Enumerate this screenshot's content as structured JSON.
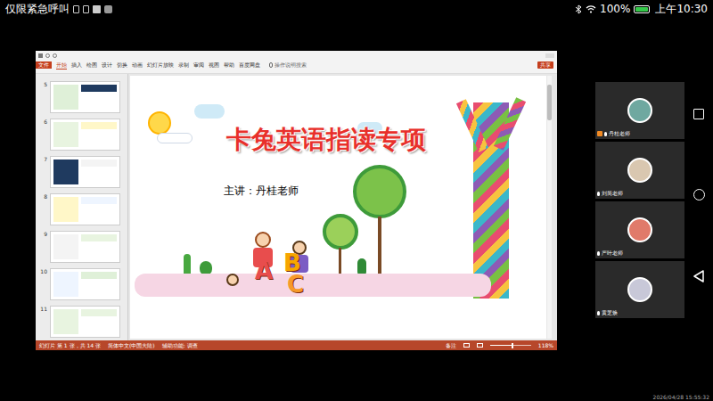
{
  "status_bar": {
    "left_text": "仅限紧急呼叫",
    "battery": "100%",
    "battery_level": 1,
    "time": "上午10:30"
  },
  "ppt": {
    "ribbon_tabs": [
      {
        "label": "文件",
        "selected": false,
        "kind": "file"
      },
      {
        "label": "开始",
        "selected": true,
        "kind": "tab"
      },
      {
        "label": "插入",
        "selected": false,
        "kind": "tab"
      },
      {
        "label": "绘图",
        "selected": false,
        "kind": "tab"
      },
      {
        "label": "设计",
        "selected": false,
        "kind": "tab"
      },
      {
        "label": "切换",
        "selected": false,
        "kind": "tab"
      },
      {
        "label": "动画",
        "selected": false,
        "kind": "tab"
      },
      {
        "label": "幻灯片放映",
        "selected": false,
        "kind": "tab"
      },
      {
        "label": "录制",
        "selected": false,
        "kind": "tab"
      },
      {
        "label": "审阅",
        "selected": false,
        "kind": "tab"
      },
      {
        "label": "视图",
        "selected": false,
        "kind": "tab"
      },
      {
        "label": "帮助",
        "selected": false,
        "kind": "tab"
      },
      {
        "label": "百度网盘",
        "selected": false,
        "kind": "tab"
      }
    ],
    "search": "操作说明搜索",
    "share": "共享",
    "thumbnails": [
      {
        "number": "5"
      },
      {
        "number": "6"
      },
      {
        "number": "7"
      },
      {
        "number": "8"
      },
      {
        "number": "9"
      },
      {
        "number": "10"
      },
      {
        "number": "11"
      }
    ],
    "slide": {
      "title": "卡兔英语指读专项",
      "speaker": "主讲：丹桂老师",
      "letters": [
        "A",
        "B",
        "C"
      ]
    },
    "status": {
      "slide_info": "幻灯片 第 1 张，共 14 张",
      "language": "简体中文(中国大陆)",
      "accessibility": "辅助功能: 调查",
      "notes": "备注",
      "zoom": "118%",
      "zoom_level": 0.55
    }
  },
  "participants": [
    {
      "name": "丹桂老师",
      "sharing": true
    },
    {
      "name": "刘简老师",
      "sharing": false
    },
    {
      "name": "严叶老师",
      "sharing": false
    },
    {
      "name": "黄芝焕",
      "sharing": false
    }
  ],
  "watermark": "2026/04/28 15:55:32"
}
